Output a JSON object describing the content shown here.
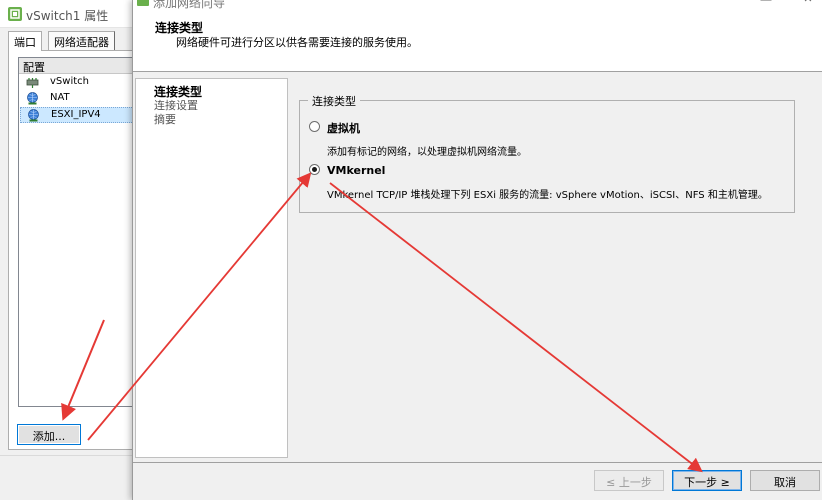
{
  "background_window": {
    "title": "vSwitch1 属性",
    "tabs": [
      "端口",
      "网络适配器"
    ],
    "list_header": "配置",
    "items": [
      {
        "label": "vSwitch",
        "icon": "switch-icon"
      },
      {
        "label": "NAT",
        "icon": "network-globe-icon"
      },
      {
        "label": "ESXI_IPV4",
        "icon": "network-globe-icon",
        "selected": true
      }
    ],
    "add_button": "添加..."
  },
  "wizard": {
    "title": "添加网络向导",
    "step_heading": "连接类型",
    "step_description": "网络硬件可进行分区以供各需要连接的服务使用。",
    "nav_items": [
      "连接类型",
      "连接设置",
      "摘要"
    ],
    "group_title": "连接类型",
    "options": [
      {
        "label": "虚拟机",
        "description": "添加有标记的网络，以处理虚拟机网络流量。",
        "selected": false
      },
      {
        "label": "VMkernel",
        "description": "VMkernel TCP/IP 堆栈处理下列 ESXi 服务的流量: vSphere vMotion、iSCSI、NFS 和主机管理。",
        "selected": true
      }
    ],
    "buttons": {
      "back": "≤ 上一步",
      "next": "下一步 ≥",
      "cancel": "取消"
    }
  },
  "colors": {
    "annotation_arrow": "#e53935",
    "selection": "#cce8ff",
    "focus_border": "#0078d7"
  }
}
